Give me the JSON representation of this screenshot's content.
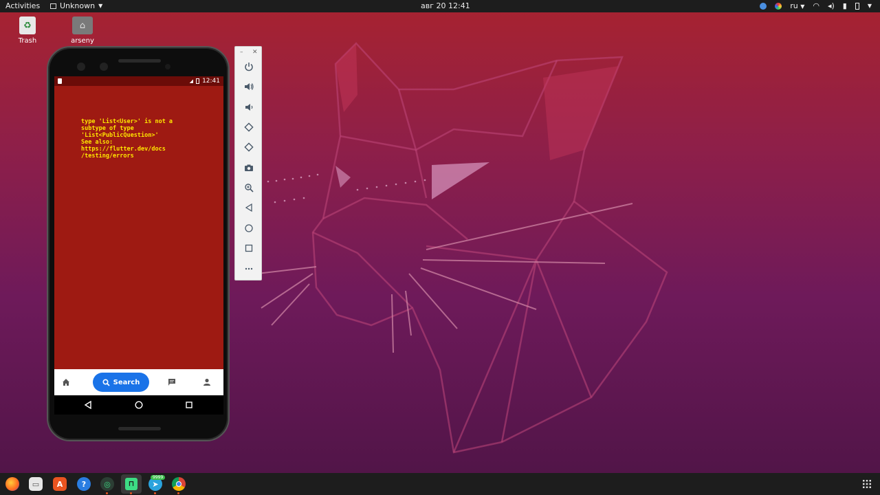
{
  "topbar": {
    "activities": "Activities",
    "app_name": "Unknown",
    "clock": "авг 20  12:41",
    "lang": "ru"
  },
  "desktop": {
    "icons": [
      {
        "label": "Trash",
        "icon": "trash-icon"
      },
      {
        "label": "arseny",
        "icon": "home-folder-icon"
      }
    ]
  },
  "emulator": {
    "statusbar": {
      "time": "12:41"
    },
    "error_text": "type 'List<User>' is not a\nsubtype of type\n'List<PublicQuestion>'\nSee also:\nhttps://flutter.dev/docs\n/testing/errors",
    "bottom_nav": {
      "search_label": "Search",
      "items": [
        "home-icon",
        "search-icon",
        "chat-icon",
        "person-icon"
      ]
    },
    "toolbar": {
      "buttons": [
        "power-icon",
        "volume-up-icon",
        "volume-down-icon",
        "rotate-left-icon",
        "rotate-right-icon",
        "camera-icon",
        "zoom-icon",
        "back-icon",
        "home-icon",
        "overview-icon",
        "more-icon"
      ]
    }
  },
  "dock": {
    "apps": [
      "firefox-icon",
      "files-icon",
      "software-icon",
      "help-icon",
      "android-studio-icon",
      "terminal-icon",
      "telegram-icon",
      "chrome-icon"
    ],
    "telegram_badge": "9999"
  },
  "colors": {
    "error_bg": "#9e1a12",
    "error_text": "#ffe600",
    "accent": "#1a73e8"
  }
}
